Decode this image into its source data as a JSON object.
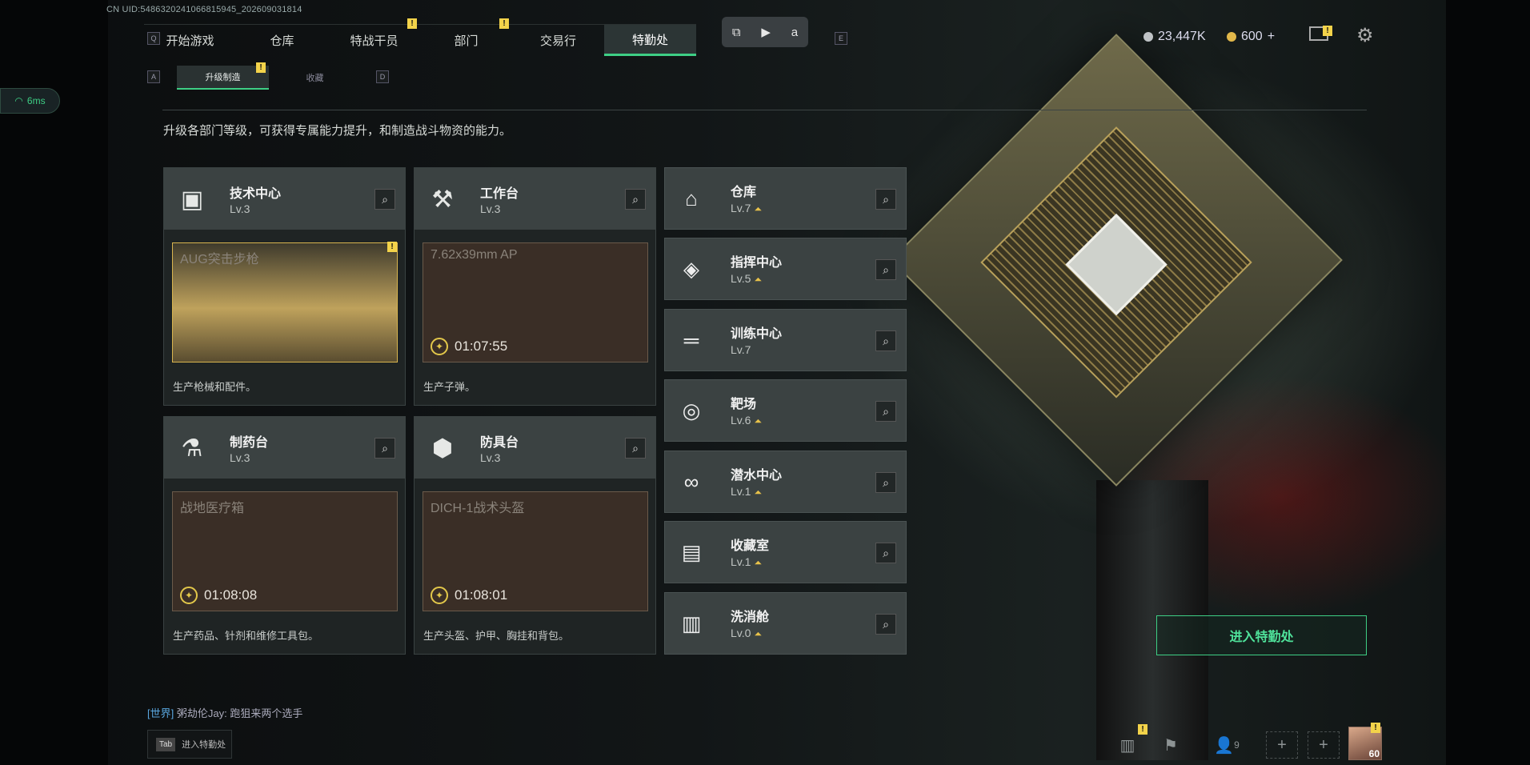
{
  "uid": "CN UID:5486320241066815945_202609031814",
  "nav": {
    "key_left": "Q",
    "key_right": "E",
    "tabs": [
      "开始游戏",
      "仓库",
      "特战干员",
      "部门",
      "交易行",
      "特勤处"
    ]
  },
  "floatbar": {
    "icons": [
      "screenshot-icon",
      "record-icon",
      "translate-icon"
    ]
  },
  "currency": {
    "silver": "23,447K",
    "gold": "600",
    "plus": "+"
  },
  "subtabs": {
    "key_left": "A",
    "key_right": "D",
    "items": [
      "升级制造",
      "收藏"
    ]
  },
  "ping": "6ms",
  "intro": "升级各部门等级，可获得专属能力提升，和制造战斗物资的能力。",
  "cards": [
    {
      "name": "技术中心",
      "level": "Lv.3",
      "product": "AUG突击步枪",
      "timer": "",
      "desc": "生产枪械和配件。"
    },
    {
      "name": "工作台",
      "level": "Lv.3",
      "product": "7.62x39mm AP",
      "timer": "01:07:55",
      "desc": "生产子弹。"
    },
    {
      "name": "制药台",
      "level": "Lv.3",
      "product": "战地医疗箱",
      "timer": "01:08:08",
      "desc": "生产药品、针剂和维修工具包。"
    },
    {
      "name": "防具台",
      "level": "Lv.3",
      "product": "DICH-1战术头盔",
      "timer": "01:08:01",
      "desc": "生产头盔、护甲、胸挂和背包。"
    }
  ],
  "rows": [
    {
      "name": "仓库",
      "level": "Lv.7"
    },
    {
      "name": "指挥中心",
      "level": "Lv.5"
    },
    {
      "name": "训练中心",
      "level": "Lv.7"
    },
    {
      "name": "靶场",
      "level": "Lv.6"
    },
    {
      "name": "潜水中心",
      "level": "Lv.1"
    },
    {
      "name": "收藏室",
      "level": "Lv.1"
    },
    {
      "name": "洗消舱",
      "level": "Lv.0"
    }
  ],
  "enter_button": "进入特勤处",
  "chat": {
    "channel": "[世界]",
    "user": "粥劫伦Jay:",
    "message": "跑狙来两个选手"
  },
  "tab_hint": {
    "key": "Tab",
    "label": "进入特勤处"
  },
  "bottom": {
    "friends_count": "9",
    "level": "60"
  }
}
